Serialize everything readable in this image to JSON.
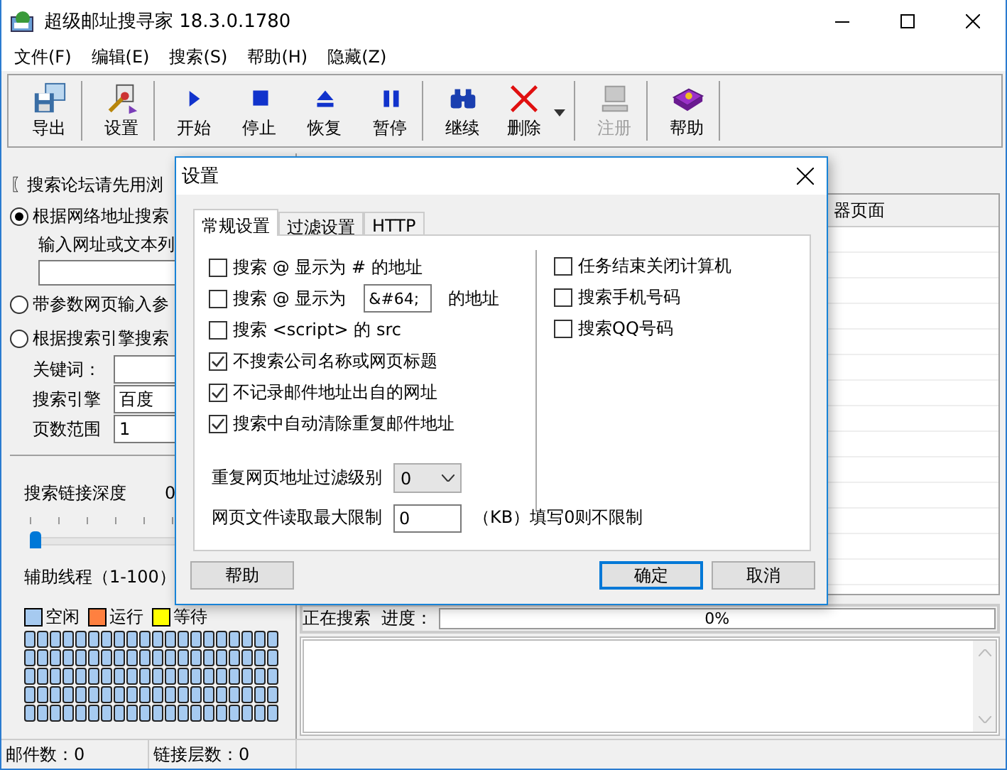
{
  "window": {
    "title": "超级邮址搜寻家 18.3.0.1780"
  },
  "menu": [
    "文件(F)",
    "编辑(E)",
    "搜索(S)",
    "帮助(H)",
    "隐藏(Z)"
  ],
  "toolbar": [
    {
      "kind": "export",
      "label": "导出",
      "disabled": false,
      "dropdown": false,
      "separator_after": true
    },
    {
      "kind": "settings",
      "label": "设置",
      "disabled": false,
      "dropdown": false,
      "separator_after": true
    },
    {
      "kind": "start",
      "label": "开始",
      "disabled": false,
      "dropdown": false,
      "separator_after": false
    },
    {
      "kind": "stop",
      "label": "停止",
      "disabled": false,
      "dropdown": false,
      "separator_after": false
    },
    {
      "kind": "resume",
      "label": "恢复",
      "disabled": false,
      "dropdown": false,
      "separator_after": false
    },
    {
      "kind": "pause",
      "label": "暂停",
      "disabled": false,
      "dropdown": false,
      "separator_after": true
    },
    {
      "kind": "continue",
      "label": "继续",
      "disabled": false,
      "dropdown": false,
      "separator_after": false
    },
    {
      "kind": "delete",
      "label": "删除",
      "disabled": false,
      "dropdown": true,
      "separator_after": true
    },
    {
      "kind": "register",
      "label": "注册",
      "disabled": true,
      "dropdown": false,
      "separator_after": true
    },
    {
      "kind": "help",
      "label": "帮助",
      "disabled": false,
      "dropdown": false,
      "separator_after": true
    }
  ],
  "left_panel": {
    "notice": "〖搜索论坛请先用浏",
    "modes": [
      {
        "label": "根据网络地址搜索",
        "selected": true
      },
      {
        "label": "带参数网页输入参",
        "selected": false
      },
      {
        "label": "根据搜索引擎搜索",
        "selected": false
      }
    ],
    "url_prompt": "输入网址或文本列",
    "keyword_label": "关键词：",
    "engine_label": "搜索引擎",
    "engine_value": "百度",
    "pages_label": "页数范围",
    "pages_value": "1",
    "depth": {
      "label": "搜索链接深度",
      "reading": "0",
      "level": 0
    },
    "threads": {
      "label": "辅助线程（1-100）",
      "legend": [
        {
          "kind": "idle",
          "label": "空闲",
          "color": "#a6caf0"
        },
        {
          "kind": "running",
          "label": "运行",
          "color": "#ff8040"
        },
        {
          "kind": "waiting",
          "label": "等待",
          "color": "#ffff00"
        }
      ],
      "cells": [
        {
          "kind": "idle"
        },
        {
          "kind": "idle"
        },
        {
          "kind": "idle"
        },
        {
          "kind": "idle"
        },
        {
          "kind": "idle"
        },
        {
          "kind": "idle"
        },
        {
          "kind": "idle"
        },
        {
          "kind": "idle"
        },
        {
          "kind": "idle"
        },
        {
          "kind": "idle"
        },
        {
          "kind": "idle"
        },
        {
          "kind": "idle"
        },
        {
          "kind": "idle"
        },
        {
          "kind": "idle"
        },
        {
          "kind": "idle"
        },
        {
          "kind": "idle"
        },
        {
          "kind": "idle"
        },
        {
          "kind": "idle"
        },
        {
          "kind": "idle"
        },
        {
          "kind": "idle"
        },
        {
          "kind": "idle"
        },
        {
          "kind": "idle"
        },
        {
          "kind": "idle"
        },
        {
          "kind": "idle"
        },
        {
          "kind": "idle"
        },
        {
          "kind": "idle"
        },
        {
          "kind": "idle"
        },
        {
          "kind": "idle"
        },
        {
          "kind": "idle"
        },
        {
          "kind": "idle"
        },
        {
          "kind": "idle"
        },
        {
          "kind": "idle"
        },
        {
          "kind": "idle"
        },
        {
          "kind": "idle"
        },
        {
          "kind": "idle"
        },
        {
          "kind": "idle"
        },
        {
          "kind": "idle"
        },
        {
          "kind": "idle"
        },
        {
          "kind": "idle"
        },
        {
          "kind": "idle"
        },
        {
          "kind": "idle"
        },
        {
          "kind": "idle"
        },
        {
          "kind": "idle"
        },
        {
          "kind": "idle"
        },
        {
          "kind": "idle"
        },
        {
          "kind": "idle"
        },
        {
          "kind": "idle"
        },
        {
          "kind": "idle"
        },
        {
          "kind": "idle"
        },
        {
          "kind": "idle"
        },
        {
          "kind": "idle"
        },
        {
          "kind": "idle"
        },
        {
          "kind": "idle"
        },
        {
          "kind": "idle"
        },
        {
          "kind": "idle"
        },
        {
          "kind": "idle"
        },
        {
          "kind": "idle"
        },
        {
          "kind": "idle"
        },
        {
          "kind": "idle"
        },
        {
          "kind": "idle"
        },
        {
          "kind": "idle"
        },
        {
          "kind": "idle"
        },
        {
          "kind": "idle"
        },
        {
          "kind": "idle"
        },
        {
          "kind": "idle"
        },
        {
          "kind": "idle"
        },
        {
          "kind": "idle"
        },
        {
          "kind": "idle"
        },
        {
          "kind": "idle"
        },
        {
          "kind": "idle"
        },
        {
          "kind": "idle"
        },
        {
          "kind": "idle"
        },
        {
          "kind": "idle"
        },
        {
          "kind": "idle"
        },
        {
          "kind": "idle"
        },
        {
          "kind": "idle"
        },
        {
          "kind": "idle"
        },
        {
          "kind": "idle"
        },
        {
          "kind": "idle"
        },
        {
          "kind": "idle"
        },
        {
          "kind": "idle"
        },
        {
          "kind": "idle"
        },
        {
          "kind": "idle"
        },
        {
          "kind": "idle"
        },
        {
          "kind": "idle"
        },
        {
          "kind": "idle"
        },
        {
          "kind": "idle"
        },
        {
          "kind": "idle"
        },
        {
          "kind": "idle"
        },
        {
          "kind": "idle"
        },
        {
          "kind": "idle"
        },
        {
          "kind": "idle"
        },
        {
          "kind": "idle"
        },
        {
          "kind": "idle"
        },
        {
          "kind": "idle"
        },
        {
          "kind": "idle"
        },
        {
          "kind": "idle"
        },
        {
          "kind": "idle"
        },
        {
          "kind": "idle"
        },
        {
          "kind": "idle"
        }
      ]
    }
  },
  "right_panel": {
    "column_header": "器页面",
    "progress": {
      "label": "正在搜索  进度：",
      "level": 0,
      "reading": "0%"
    }
  },
  "status_bar": [
    "邮件数：0",
    "链接层数：0"
  ],
  "dialog": {
    "title": "设置",
    "tabs": [
      {
        "label": "常规设置",
        "selected": true
      },
      {
        "label": "过滤设置",
        "selected": false
      },
      {
        "label": "HTTP",
        "selected": false
      }
    ],
    "left_options": [
      {
        "kind": "check",
        "label": "搜索 @ 显示为 # 的地址",
        "checked": false
      },
      {
        "kind": "check_field",
        "label": "搜索 @ 显示为",
        "value": "&#64;",
        "suffix": "的地址",
        "checked": false
      },
      {
        "kind": "check",
        "label": "搜索 <script> 的 src",
        "checked": false
      },
      {
        "kind": "check",
        "label": "不搜索公司名称或网页标题",
        "checked": true
      },
      {
        "kind": "check",
        "label": "不记录邮件地址出自的网址",
        "checked": true
      },
      {
        "kind": "check",
        "label": "搜索中自动清除重复邮件地址",
        "checked": true
      }
    ],
    "right_options": [
      {
        "label": "任务结束关闭计算机",
        "checked": false
      },
      {
        "label": "搜索手机号码",
        "checked": false
      },
      {
        "label": "搜索QQ号码",
        "checked": false
      }
    ],
    "filter_level": {
      "label": "重复网页地址过滤级别",
      "value": "0"
    },
    "max_size": {
      "label": "网页文件读取最大限制",
      "value": "0",
      "note": "（KB）填写0则不限制"
    },
    "buttons": [
      {
        "label": "帮助",
        "default": false
      },
      {
        "label": "确定",
        "default": true
      },
      {
        "label": "取消",
        "default": false
      }
    ]
  }
}
